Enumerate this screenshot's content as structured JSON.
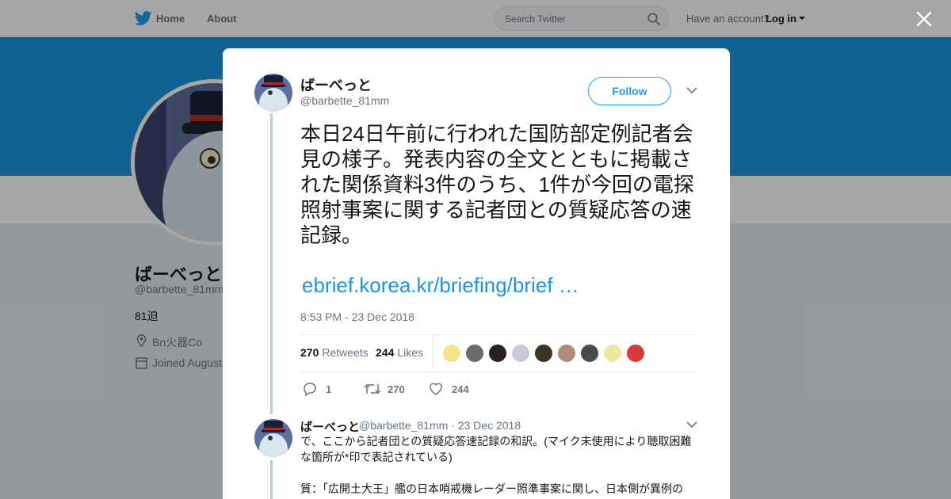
{
  "nav": {
    "home_label": "Home",
    "about_label": "About",
    "search_placeholder": "Search Twitter",
    "account_prompt": "Have an account?",
    "login_label": "Log in"
  },
  "profile": {
    "name": "ばーべっと",
    "handle": "@barbette_81mm",
    "bio": "81迫",
    "location": "Bn火器Co",
    "joined": "Joined August"
  },
  "tweet": {
    "author_name": "ばーべっと",
    "author_handle": "@barbette_81mm",
    "follow_label": "Follow",
    "text": "本日24日午前に行われた国防部定例記者会見の様子。発表内容の全文とともに掲載された関係資料3件のうち、1件が今回の電探照射事案に関する記者団との質疑応答の速記録。",
    "link_text": "ebrief.korea.kr/briefing/brief …",
    "timestamp": "8:53 PM - 23 Dec 2018",
    "retweets_count": "270",
    "retweets_label": "Retweets",
    "likes_count": "244",
    "likes_label": "Likes",
    "reply_action_count": "1",
    "retweet_action_count": "270",
    "like_action_count": "244"
  },
  "reply": {
    "author_name": "ばーべっと",
    "meta": "@barbette_81mm · 23 Dec 2018",
    "text1": "で、ここから記者団との質疑応答速記録の和訳。(マイク未使用により聴取困難な箇所が*印で表記されている)",
    "text2": "質：「広開土大王」艦の日本哨戒機レーダー照準事案に関し、日本側が異例の"
  },
  "colors": {
    "brand_blue": "#1da1f2",
    "banner": "#1b95e0",
    "link": "#1b95e0",
    "thread_line": "#a2d2f2"
  },
  "icons": [
    "twitter-bird-icon",
    "search-icon",
    "close-icon",
    "chevron-down-icon",
    "location-pin-icon",
    "calendar-icon",
    "reply-icon",
    "retweet-icon",
    "heart-icon"
  ]
}
